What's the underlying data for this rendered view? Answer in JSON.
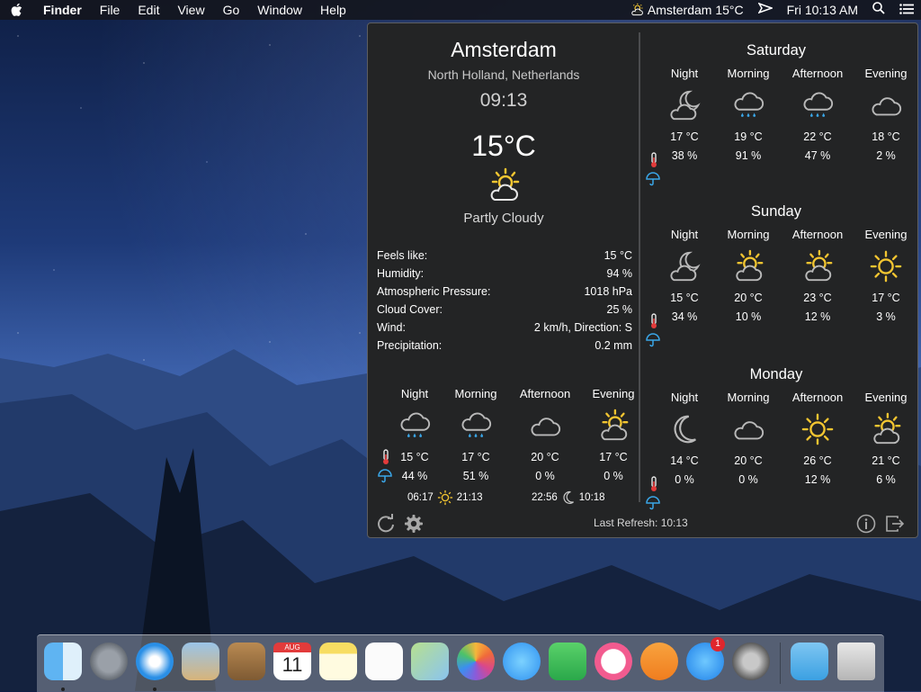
{
  "menubar": {
    "app_name": "Finder",
    "menus": [
      "File",
      "Edit",
      "View",
      "Go",
      "Window",
      "Help"
    ],
    "weather_status": "Amsterdam 15°C",
    "clock": "Fri 10:13 AM"
  },
  "current": {
    "city": "Amsterdam",
    "region": "North Holland, Netherlands",
    "time": "09:13",
    "temperature": "15°C",
    "condition": "Partly Cloudy",
    "details": [
      {
        "label": "Feels like:",
        "value": "15 °C"
      },
      {
        "label": "Humidity:",
        "value": "94 %"
      },
      {
        "label": "Atmospheric Pressure:",
        "value": "1018 hPa"
      },
      {
        "label": "Cloud Cover:",
        "value": "25 %"
      },
      {
        "label": "Wind:",
        "value": "2 km/h, Direction: S"
      },
      {
        "label": "Precipitation:",
        "value": "0.2 mm"
      }
    ],
    "today": [
      {
        "period": "Night",
        "icon": "rain-cloud-icon",
        "temp": "15 °C",
        "precip": "44 %"
      },
      {
        "period": "Morning",
        "icon": "rain-cloud-icon",
        "temp": "17 °C",
        "precip": "51 %"
      },
      {
        "period": "Afternoon",
        "icon": "cloud-icon",
        "temp": "20 °C",
        "precip": "0 %"
      },
      {
        "period": "Evening",
        "icon": "partly-cloudy-icon",
        "temp": "17 °C",
        "precip": "0 %"
      }
    ],
    "sunrise": "06:17",
    "sunset": "21:13",
    "moonrise": "22:56",
    "moonset": "10:18"
  },
  "forecast": [
    {
      "day": "Saturday",
      "periods": [
        {
          "period": "Night",
          "icon": "moon-cloud-icon",
          "temp": "17 °C",
          "precip": "38 %"
        },
        {
          "period": "Morning",
          "icon": "rain-cloud-icon",
          "temp": "19 °C",
          "precip": "91 %"
        },
        {
          "period": "Afternoon",
          "icon": "rain-cloud-icon",
          "temp": "22 °C",
          "precip": "47 %"
        },
        {
          "period": "Evening",
          "icon": "cloud-icon",
          "temp": "18 °C",
          "precip": "2 %"
        }
      ]
    },
    {
      "day": "Sunday",
      "periods": [
        {
          "period": "Night",
          "icon": "moon-cloud-icon",
          "temp": "15 °C",
          "precip": "34 %"
        },
        {
          "period": "Morning",
          "icon": "partly-cloudy-icon",
          "temp": "20 °C",
          "precip": "10 %"
        },
        {
          "period": "Afternoon",
          "icon": "partly-cloudy-icon",
          "temp": "23 °C",
          "precip": "12 %"
        },
        {
          "period": "Evening",
          "icon": "sun-icon",
          "temp": "17 °C",
          "precip": "3 %"
        }
      ]
    },
    {
      "day": "Monday",
      "periods": [
        {
          "period": "Night",
          "icon": "moon-icon",
          "temp": "14 °C",
          "precip": "0 %"
        },
        {
          "period": "Morning",
          "icon": "cloud-icon",
          "temp": "20 °C",
          "precip": "0 %"
        },
        {
          "period": "Afternoon",
          "icon": "sun-icon",
          "temp": "26 °C",
          "precip": "12 %"
        },
        {
          "period": "Evening",
          "icon": "partly-cloudy-icon",
          "temp": "21 °C",
          "precip": "6 %"
        }
      ]
    }
  ],
  "footer": {
    "last_refresh": "Last Refresh: 10:13"
  },
  "dock": {
    "items": [
      "finder-icon",
      "launchpad-icon",
      "safari-icon",
      "mail-icon",
      "contacts-icon",
      "calendar-icon",
      "notes-icon",
      "reminders-icon",
      "maps-icon",
      "photos-icon",
      "messages-icon",
      "facetime-icon",
      "itunes-icon",
      "ibooks-icon",
      "app-store-icon",
      "system-preferences-icon",
      "downloads-folder-icon",
      "trash-icon"
    ],
    "calendar_month": "AUG",
    "calendar_day": "11",
    "app_store_badge": "1"
  },
  "colors": {
    "widget_bg": "#232425",
    "sun": "#f2c531",
    "cloud": "#b9b9b9",
    "rain": "#3aa6e8"
  }
}
